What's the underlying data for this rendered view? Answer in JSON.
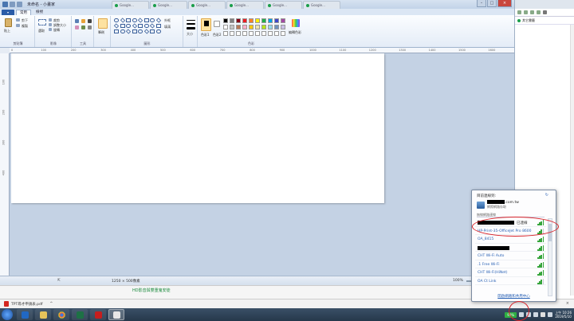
{
  "paint": {
    "title": "未命名 - 小畫家",
    "file_menu": "",
    "tabs": [
      "常用",
      "檢視"
    ],
    "groups": {
      "clipboard": "剪貼簿",
      "image": "影像",
      "tools": "工具",
      "shapes": "圖形",
      "colors": "色彩"
    },
    "buttons": {
      "paste": "貼上",
      "cut": "剪下",
      "copy": "複製",
      "select": "選取",
      "crop": "裁剪",
      "resize": "調整大小",
      "rotate": "旋轉",
      "brush": "筆刷",
      "outline": "外框",
      "fill": "填滿",
      "size": "大小",
      "color1": "色彩1",
      "color2": "色彩2",
      "edit_colors": "編輯色彩"
    },
    "ruler_ticks": [
      "0",
      "100",
      "200",
      "300",
      "400",
      "500",
      "600",
      "700",
      "800",
      "900",
      "1000",
      "1100",
      "1200",
      "1300",
      "1400",
      "1500",
      "1600"
    ],
    "vruler_ticks": [
      "100",
      "200",
      "300",
      "400"
    ],
    "status": {
      "canvas_size": "1250 × 500像素",
      "zoom": "100%"
    },
    "palette": [
      "#000000",
      "#7f7f7f",
      "#880015",
      "#ed1c24",
      "#ff7f27",
      "#fff200",
      "#22b14c",
      "#00a2e8",
      "#3f48cc",
      "#a349a4",
      "#ffffff",
      "#c3c3c3",
      "#b97a57",
      "#ffaec9",
      "#ffc90e",
      "#efe4b0",
      "#b5e61d",
      "#99d9ea",
      "#7092be",
      "#c8bfe7"
    ]
  },
  "browser_tabs": [
    {
      "label": "Google..."
    },
    {
      "label": "Google..."
    },
    {
      "label": "Google..."
    },
    {
      "label": "Google..."
    },
    {
      "label": "Google..."
    },
    {
      "label": "Google..."
    },
    {
      "label": "Google..."
    }
  ],
  "right_pane": {
    "bookmark": "其它書籤"
  },
  "below_paint_text": "HD影音與雙重鬼安徒",
  "downloads": {
    "file": "TPT尋才申請表.pdf",
    "close": "×"
  },
  "network_popup": {
    "title": "目前連線到:",
    "current_domain": ".com.tw",
    "current_sub": "網際網路存取",
    "section": "無線網路連線",
    "connected_label": "已連線",
    "networks": [
      {
        "name": "",
        "status": "已連線",
        "redacted": true,
        "bars": 4
      },
      {
        "name": "HP-Print-35-OfficeJet Pro 8600",
        "status": "",
        "redacted": false,
        "bars": 3
      },
      {
        "name": "OA_8415",
        "status": "",
        "redacted": false,
        "bars": 4
      },
      {
        "name": "",
        "status": "",
        "redacted": true,
        "bars": 4
      },
      {
        "name": "CHT Wi-Fi Auto",
        "status": "",
        "redacted": false,
        "bars": 4
      },
      {
        "name": ".1 Free Wi-Fi",
        "status": "",
        "redacted": false,
        "bars": 4
      },
      {
        "name": "CHT Wi-Fi(HiNet)",
        "status": "",
        "redacted": false,
        "bars": 4
      },
      {
        "name": "OA Ct Link",
        "status": "",
        "redacted": false,
        "bars": 3
      }
    ],
    "footer": "開啟網路和共用中心"
  },
  "taskbar": {
    "battery": "99%",
    "time": "上午 10:26",
    "date": "2019/5/10"
  },
  "colors": {
    "accent": "#2a5ca8",
    "annotation": "#d8232a",
    "signal": "#35a53a",
    "link": "#2a62b5"
  }
}
